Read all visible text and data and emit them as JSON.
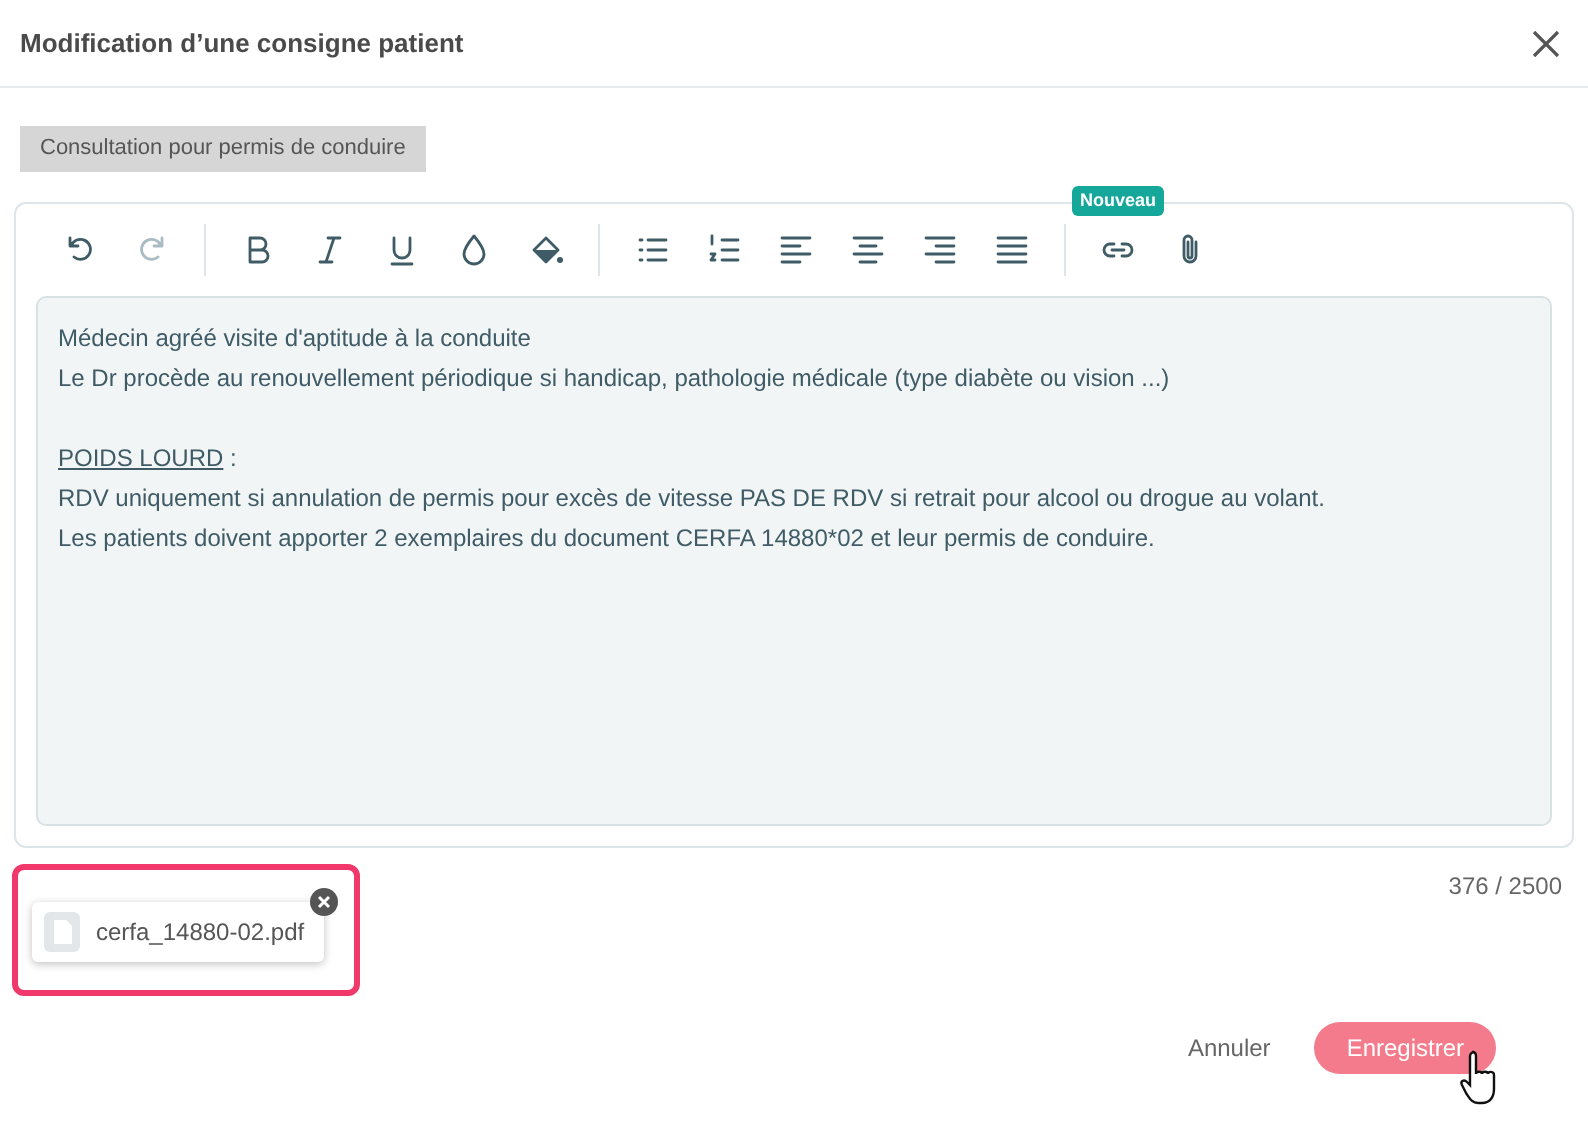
{
  "dialog": {
    "title": "Modification d’une consigne patient"
  },
  "tag": "Consultation pour permis de conduire",
  "toolbar": {
    "groups": [
      [
        {
          "kind": "undo",
          "disabled": false
        },
        {
          "kind": "redo",
          "disabled": true
        }
      ],
      [
        {
          "kind": "bold",
          "disabled": false
        },
        {
          "kind": "italic",
          "disabled": false
        },
        {
          "kind": "underline",
          "disabled": false
        },
        {
          "kind": "text-color",
          "disabled": false
        },
        {
          "kind": "fill",
          "disabled": false
        }
      ],
      [
        {
          "kind": "bullets",
          "disabled": false
        },
        {
          "kind": "numbers",
          "disabled": false
        },
        {
          "kind": "align-left",
          "disabled": false
        },
        {
          "kind": "align-center",
          "disabled": false
        },
        {
          "kind": "align-right",
          "disabled": false
        },
        {
          "kind": "justify",
          "disabled": false
        }
      ],
      [
        {
          "kind": "link",
          "disabled": false,
          "badge": "Nouveau"
        },
        {
          "kind": "attach",
          "disabled": false
        }
      ]
    ]
  },
  "content": [
    {
      "kind": "text",
      "text": "Médecin agréé visite d'aptitude à la conduite"
    },
    {
      "kind": "text",
      "text": "Le Dr procède au renouvellement périodique si handicap, pathologie médicale (type diabète ou vision ...)"
    },
    {
      "kind": "blank"
    },
    {
      "kind": "labelled",
      "label": "POIDS LOURD",
      "text": " :"
    },
    {
      "kind": "text",
      "text": "RDV uniquement si annulation de permis pour excès de vitesse PAS DE RDV si retrait pour alcool ou drogue au volant."
    },
    {
      "kind": "text",
      "text": "Les patients doivent apporter 2 exemplaires du document CERFA 14880*02 et leur permis de conduire."
    }
  ],
  "counter": "376 / 2500",
  "attachments": [
    {
      "name": "cerfa_14880-02.pdf",
      "highlighted": true
    }
  ],
  "buttons": {
    "cancel": "Annuler",
    "save": "Enregistrer"
  }
}
